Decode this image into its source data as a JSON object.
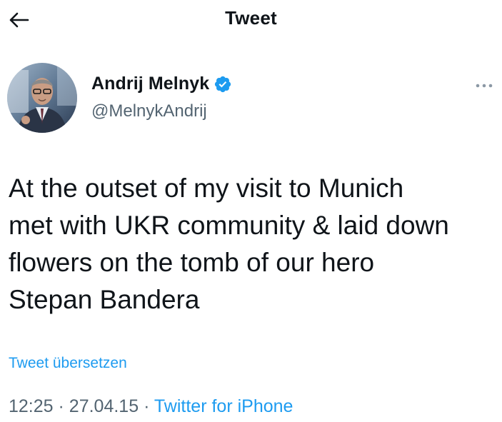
{
  "header": {
    "title": "Tweet"
  },
  "tweet": {
    "author_name": "Andrij Melnyk",
    "author_handle": "@MelnykAndrij",
    "text": "At the outset of my visit to Munich\nmet with UKR community & laid down\nflowers on the tomb of our hero\nStepan Bandera",
    "translate_label": "Tweet übersetzen",
    "time": "12:25",
    "separator": "·",
    "date": "27.04.15",
    "source": "Twitter for iPhone"
  },
  "icons": {
    "back": "back-arrow-icon",
    "verified": "verified-badge-icon",
    "more": "more-options-icon"
  },
  "colors": {
    "accent": "#1d9bf0",
    "text": "#0f1419",
    "secondary": "#536471"
  }
}
